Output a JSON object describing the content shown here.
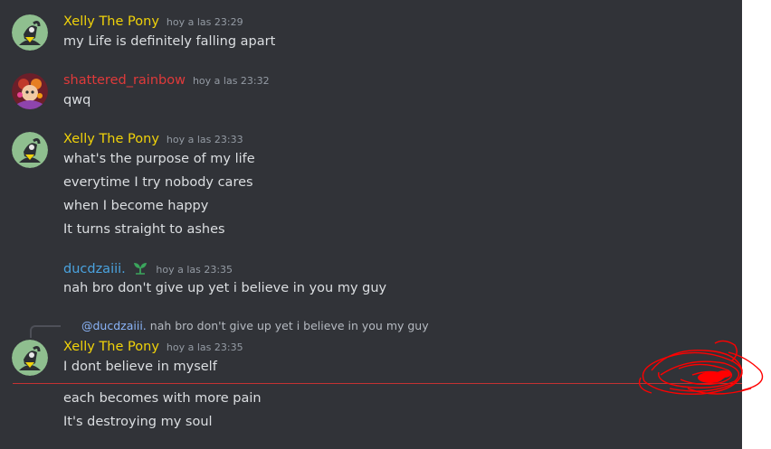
{
  "colors": {
    "background": "#313338",
    "text": "#dbdee1",
    "timestamp": "#949ba4",
    "xelly": "#f0d20a",
    "shattered": "#e03a3a",
    "ducd": "#4aa3df",
    "new_divider": "#c33232"
  },
  "messages": [
    {
      "author": "Xelly The Pony",
      "timestamp": "hoy a las 23:29",
      "lines": [
        "my Life is definitely falling apart"
      ]
    },
    {
      "author": "shattered_rainbow",
      "timestamp": "hoy a las 23:32",
      "lines": [
        "qwq"
      ]
    },
    {
      "author": "Xelly The Pony",
      "timestamp": "hoy a las 23:33",
      "lines": [
        "what's the purpose of my life",
        "everytime I try nobody cares",
        "when I become happy",
        "It turns straight to ashes"
      ]
    },
    {
      "author": "ducdzaiii.",
      "badge_icon": "sprout-icon",
      "timestamp": "hoy a las 23:35",
      "lines": [
        "nah bro don't give up yet i believe in you my guy"
      ]
    },
    {
      "reply": {
        "mention": "@ducdzaiii.",
        "text": "nah bro don't give up yet i believe in you my guy"
      },
      "author": "Xelly The Pony",
      "timestamp": "hoy a las 23:35",
      "lines": [
        "I dont believe in myself"
      ]
    }
  ],
  "after_divider_lines": [
    "each becomes with more pain",
    "It's destroying my soul"
  ]
}
